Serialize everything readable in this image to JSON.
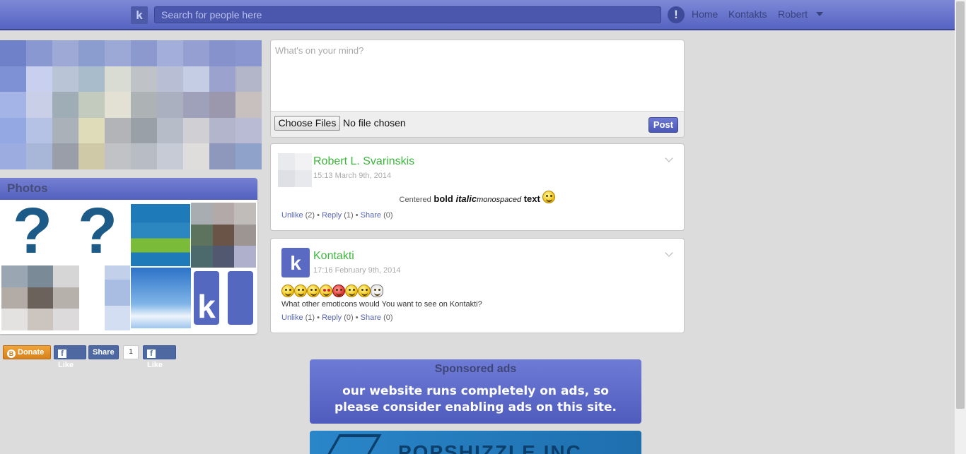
{
  "header": {
    "logo_letter": "k",
    "search_placeholder": "Search for people here",
    "alert_glyph": "!",
    "nav": {
      "home": "Home",
      "kontakts": "Kontakts",
      "user": "Robert"
    }
  },
  "sidebar": {
    "photos_title": "Photos",
    "qmark": "?",
    "k_letter": "k"
  },
  "social": {
    "donate": "Donate",
    "like": "Like",
    "share": "Share",
    "share_count": "1",
    "like2": "Like",
    "fb_glyph": "f",
    "btc_glyph": "B"
  },
  "composer": {
    "placeholder": "What's on your mind?",
    "choose_files": "Choose Files",
    "no_file": "No file chosen",
    "post": "Post"
  },
  "posts": [
    {
      "author": "Robert L. Svarinskis",
      "time": "15:13 March 9th, 2014",
      "body": {
        "centered": "Centered",
        "bold": "bold",
        "italic": "italic",
        "mono": "monospaced",
        "text": "text"
      },
      "actions": {
        "unlike": "Unlike",
        "unlike_count": "(2)",
        "reply": "Reply",
        "reply_count": "(1)",
        "share": "Share",
        "share_count": "(0)"
      }
    },
    {
      "author": "Kontakti",
      "time": "17:16 February 9th, 2014",
      "avatar_letter": "k",
      "text": "What other emoticons would You want to see on Kontakti?",
      "actions": {
        "unlike": "Unlike",
        "unlike_count": "(1)",
        "reply": "Reply",
        "reply_count": "(0)",
        "share": "Share",
        "share_count": "(0)"
      }
    }
  ],
  "ads": {
    "title": "Sponsored ads",
    "line1": "our website runs completely on ads, so",
    "line2": "please consider enabling ads on this site.",
    "banner_text": "POPSHIZZLE INC"
  },
  "colors": {
    "brand": "#5664c2",
    "author": "#3cb53c",
    "link": "#5666b8"
  }
}
